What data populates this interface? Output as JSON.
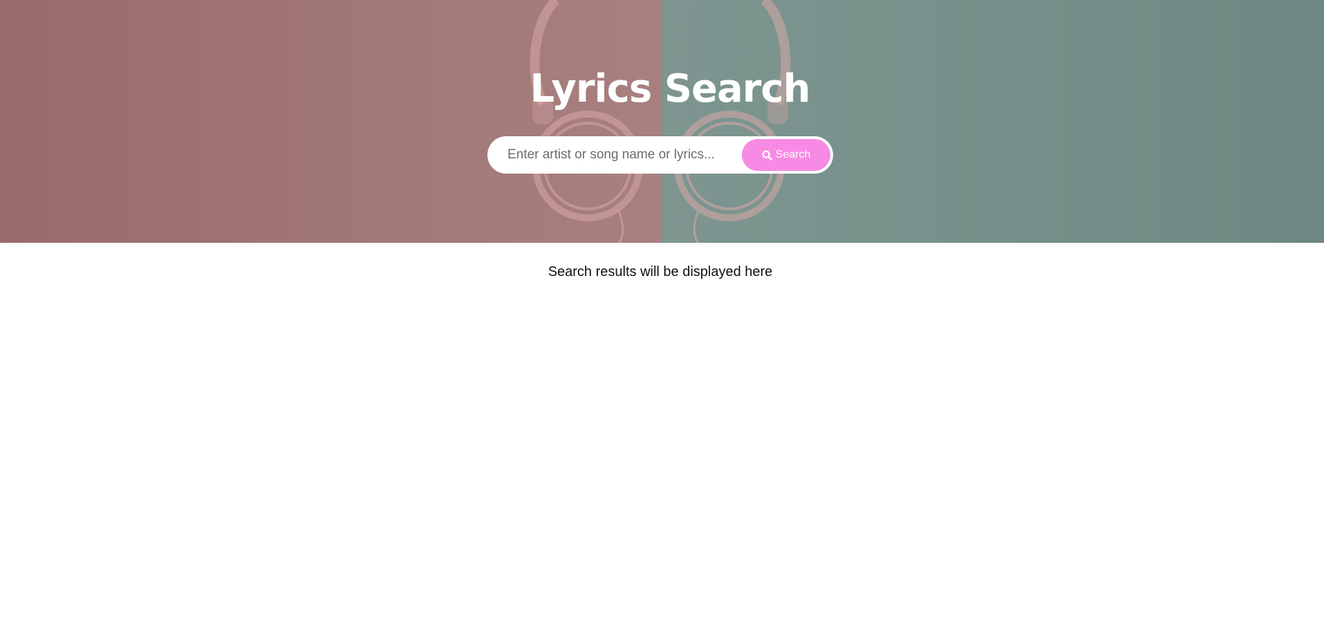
{
  "header": {
    "title": "Lyrics Search"
  },
  "search": {
    "placeholder": "Enter artist or song name or lyrics...",
    "value": "",
    "button_label": "Search",
    "button_icon": "search-icon"
  },
  "results": {
    "message": "Search results will be displayed here"
  },
  "colors": {
    "button": "#f68ae4",
    "hero_left": "#a27878",
    "hero_right": "#75908a"
  }
}
